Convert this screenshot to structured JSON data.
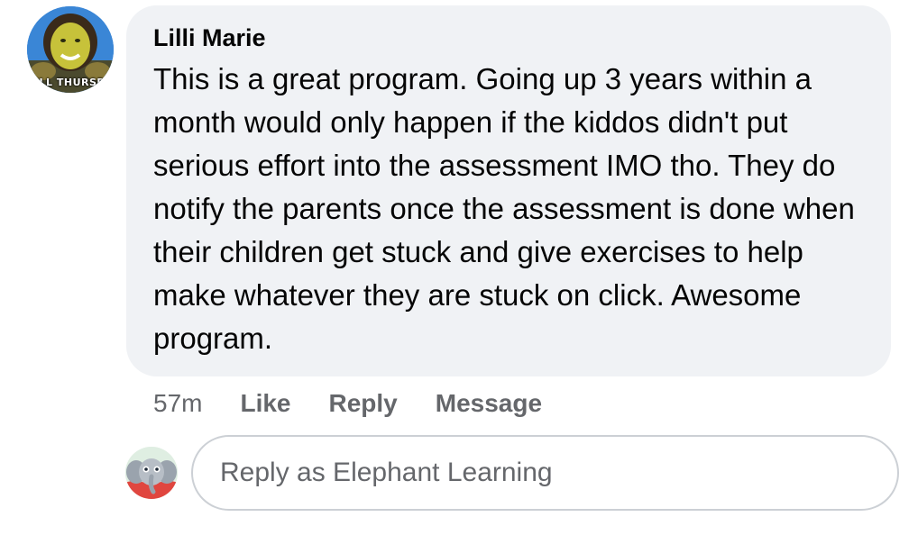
{
  "comment": {
    "author": "Lilli Marie",
    "avatar_caption": "ILL THURSD",
    "text": "This is a great program. Going up 3 years within a month would only happen if the kiddos didn't put serious effort into the assessment IMO tho. They do notify the parents once the assessment is done when their children get stuck and give exercises to help make whatever they are stuck on click. Awesome program."
  },
  "actions": {
    "time": "57m",
    "like": "Like",
    "reply": "Reply",
    "message": "Message"
  },
  "reply_box": {
    "placeholder": "Reply as Elephant Learning",
    "value": ""
  },
  "icons": {
    "commenter_avatar": "user-avatar-photo",
    "reply_avatar": "elephant-mascot-avatar"
  }
}
